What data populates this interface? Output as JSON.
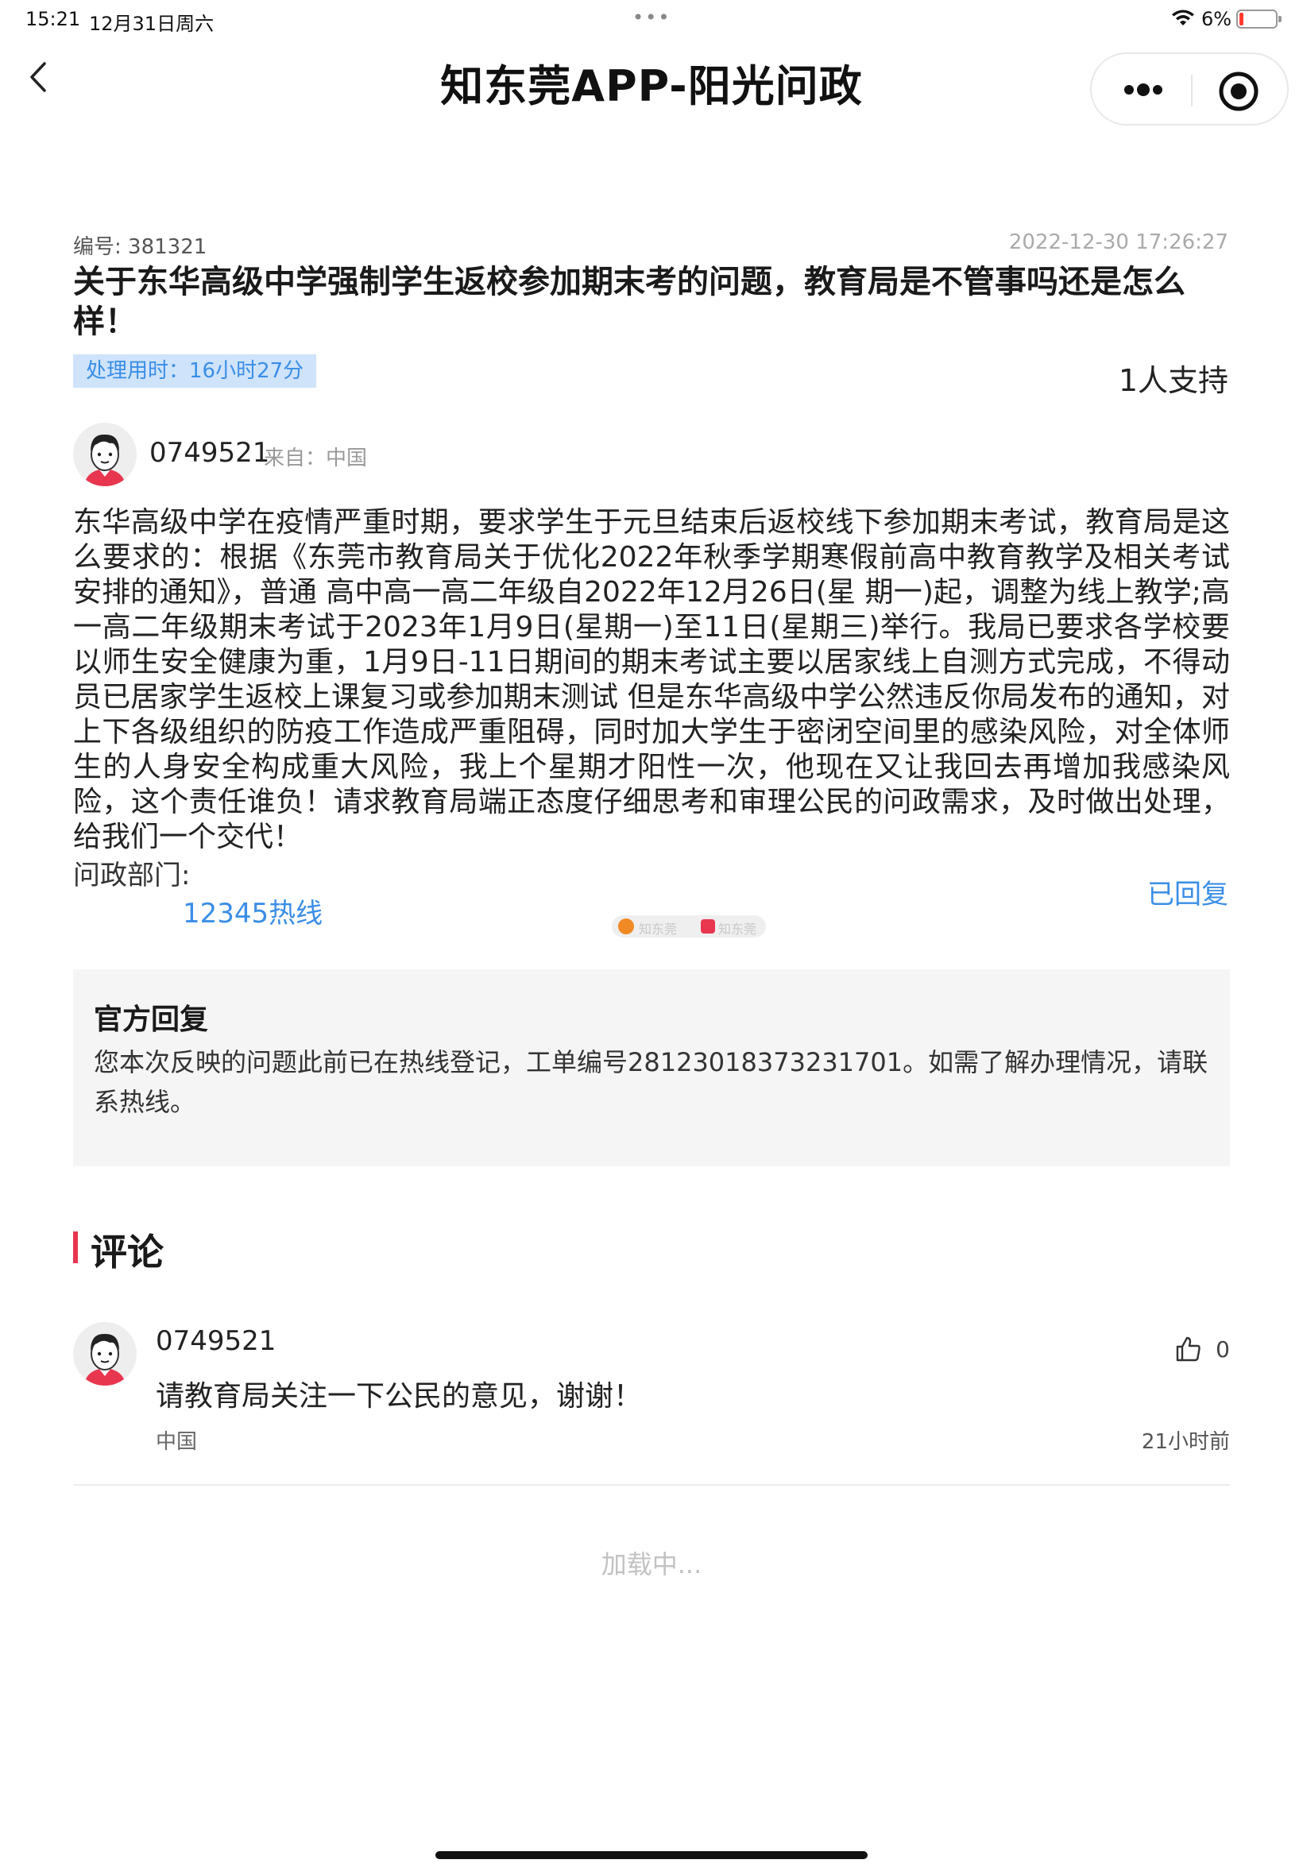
{
  "status_bar": {
    "time": "15:21",
    "date": "12月31日周六",
    "dots": "•••",
    "battery": "6%"
  },
  "nav": {
    "title": "知东莞APP-阳光问政"
  },
  "question": {
    "id_label": "编号:",
    "id": "381321",
    "datetime": "2022-12-30 17:26:27",
    "title": "关于东华高级中学强制学生返校参加期末考的问题，教育局是不管事吗还是怎么样！",
    "processing_time": "处理用时：16小时27分",
    "support": "1人支持",
    "author": "0749521",
    "from": "来自：中国",
    "body": "东华高级中学在疫情严重时期，要求学生于元旦结束后返校线下参加期末考试，教育局是这么要求的：根据《东莞市教育局关于优化2022年秋季学期寒假前高中教育教学及相关考试安排的通知》，普通 高中高一高二年级自2022年12月26日(星 期一)起，调整为线上教学;高一高二年级期末考试于2023年1月9日(星期一)至11日(星期三)举行。我局已要求各学校要以师生安全健康为重，1月9日-11日期间的期末考试主要以居家线上自测方式完成，不得动员已居家学生返校上课复习或参加期末测试 但是东华高级中学公然违反你局发布的通知，对上下各级组织的防疫工作造成严重阻碍，同时加大学生于密闭空间里的感染风险，对全体师生的人身安全构成重大风险，我上个星期才阳性一次，他现在又让我回去再增加我感染风险，这个责任谁负！请求教育局端正态度仔细思考和审理公民的问政需求，及时做出处理，给我们一个交代！",
    "dept_label": "问政部门:",
    "dept_name": "12345热线",
    "status": "已回复"
  },
  "official_reply": {
    "heading": "官方回复",
    "body": "您本次反映的问题此前已在热线登记，工单编号28123018373231701。如需了解办理情况，请联系热线。"
  },
  "comments": {
    "heading": "评论",
    "items": [
      {
        "name": "0749521",
        "text": "请教育局关注一下公民的意见，谢谢！",
        "location": "中国",
        "time": "21小时前",
        "likes": "0"
      }
    ],
    "loading": "加载中..."
  },
  "icons": {
    "back": "chevron-left-icon",
    "more": "more-dots-icon",
    "target": "target-icon",
    "like": "thumbs-up-icon",
    "wifi": "wifi-icon",
    "battery": "battery-icon"
  },
  "colors": {
    "accent_blue": "#3a8ee6",
    "accent_red": "#e8364f",
    "badge_bg": "#cfe3fb",
    "reply_bg": "#f5f5f5"
  }
}
